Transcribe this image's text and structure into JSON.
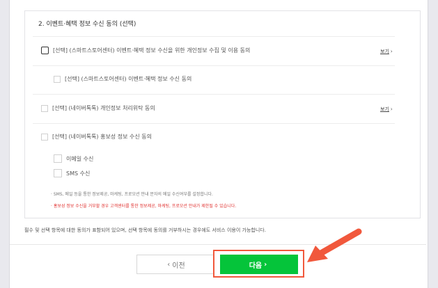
{
  "section": {
    "title": "2. 이벤트·혜택 정보 수신 동의 (선택)"
  },
  "items": {
    "smartstore_privacy": {
      "label": "[선택] (스마트스토어센터) 이벤트·혜택 정보 수신을 위한 개인정보 수집 및 이용 동의",
      "more": "보기"
    },
    "smartstore_receive": {
      "label": "[선택] (스마트스토어센터) 이벤트·혜택 정보 수신 동의"
    },
    "navertalk_consign": {
      "label": "[선택] (네이버톡톡) 개인정보 처리위탁 동의",
      "more": "보기"
    },
    "navertalk_promo": {
      "label": "[선택] (네이버톡톡) 홍보성 정보 수신 동의"
    },
    "email": {
      "label": "이메일 수신"
    },
    "sms": {
      "label": "SMS 수신"
    }
  },
  "notes": {
    "grey": "· SMS, 메일 등을 통한 정보제공, 마케팅, 프로모션 안내 문자의 메일 수신여부를 설정합니다.",
    "red": "· 홍보성 정보 수신을 거부할 경우 고객센터를 통한 정보제공, 마케팅, 프로모션 안내가 제한될 수 있습니다."
  },
  "footer_note": "필수 및 선택 항목에 대한 동의가 표함되어 있으며, 선택 항목에 동의를 거부하시는 경우에도 서비스 이용이 가능합니다.",
  "buttons": {
    "prev": "이전",
    "next": "다음"
  },
  "colors": {
    "next_button": "#05c43a",
    "highlight": "#f1583c",
    "warning_text": "#e0312f"
  }
}
